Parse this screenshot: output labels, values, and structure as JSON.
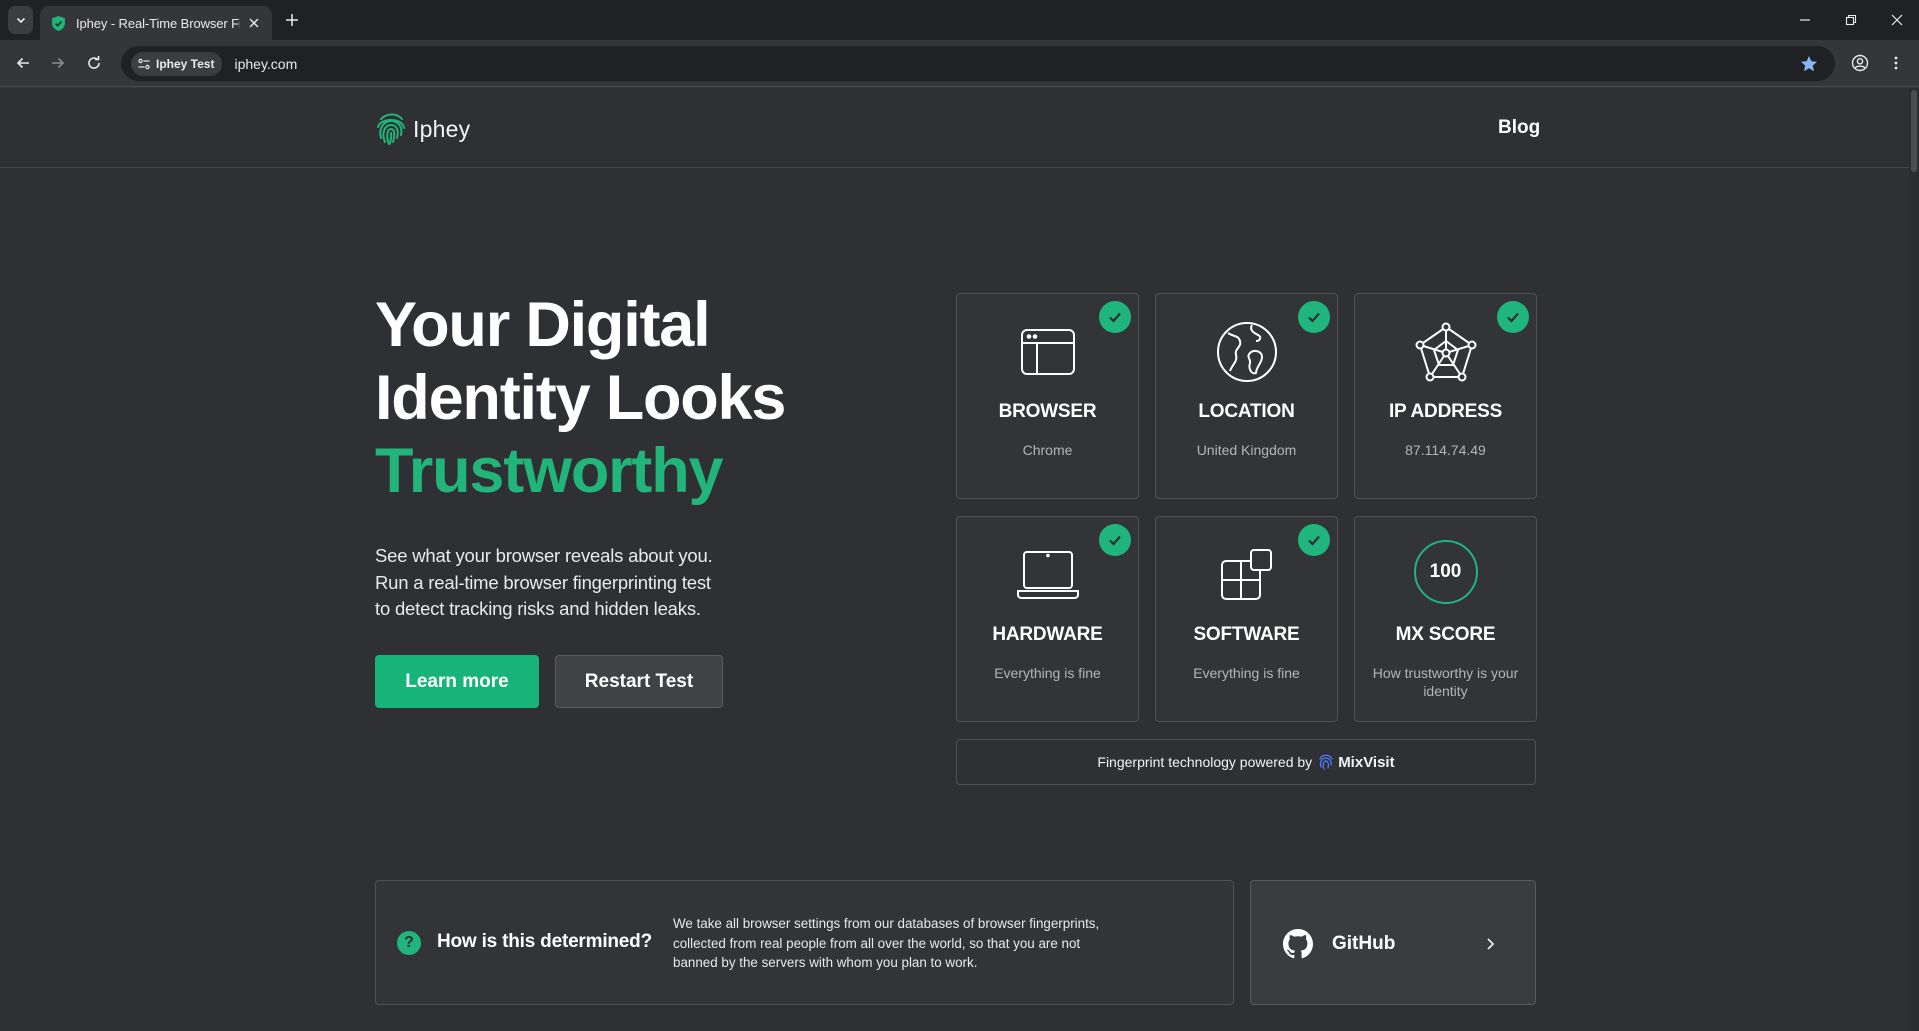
{
  "browser": {
    "tab_title": "Iphey - Real-Time Browser Fingerprint Test",
    "site_chip": "Iphey Test",
    "url": "iphey.com"
  },
  "header": {
    "logo_text": "Iphey",
    "blog_label": "Blog"
  },
  "hero": {
    "title_line1": "Your Digital",
    "title_line2": "Identity Looks",
    "title_highlight": "Trustworthy",
    "desc_line1": "See what your browser reveals about you.",
    "desc_line2": "Run a real-time browser fingerprinting test",
    "desc_line3": "to detect tracking risks and hidden leaks.",
    "learn_more": "Learn more",
    "restart": "Restart Test"
  },
  "cards": [
    {
      "title": "BROWSER",
      "sub": "Chrome",
      "icon": "browser-window-icon",
      "checked": true
    },
    {
      "title": "LOCATION",
      "sub": "United Kingdom",
      "icon": "globe-icon",
      "checked": true
    },
    {
      "title": "IP ADDRESS",
      "sub": "87.114.74.49",
      "icon": "network-nodes-icon",
      "checked": true
    },
    {
      "title": "HARDWARE",
      "sub": "Everything is fine",
      "icon": "laptop-icon",
      "checked": true
    },
    {
      "title": "SOFTWARE",
      "sub": "Everything is fine",
      "icon": "app-blocks-icon",
      "checked": true
    },
    {
      "title": "MX SCORE",
      "sub": "How trustworthy is your identity",
      "score": "100",
      "checked": false
    }
  ],
  "powered": {
    "text": "Fingerprint technology powered by",
    "brand": "MixVisit"
  },
  "info": {
    "title": "How is this determined?",
    "text": "We take all browser settings from our databases of browser fingerprints, collected from real people from all over the world, so that you are not banned by the servers with whom you plan to work."
  },
  "github": {
    "label": "GitHub"
  },
  "colors": {
    "accent": "#1fb57c",
    "background": "#2f3034",
    "card_bg": "#333438"
  }
}
